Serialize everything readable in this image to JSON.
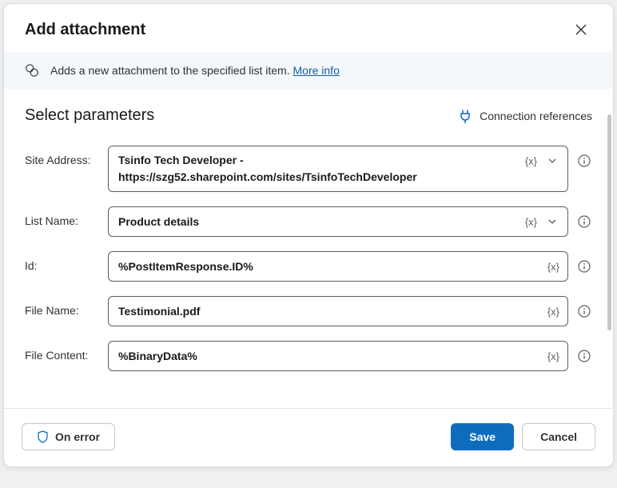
{
  "dialog": {
    "title": "Add attachment",
    "description": "Adds a new attachment to the specified list item.",
    "more_info_label": "More info"
  },
  "params": {
    "heading": "Select parameters",
    "connection_label": "Connection references"
  },
  "fields": {
    "site_address": {
      "label": "Site Address:",
      "value": "Tsinfo Tech Developer - https://szg52.sharepoint.com/sites/TsinfoTechDeveloper"
    },
    "list_name": {
      "label": "List Name:",
      "value": "Product details"
    },
    "id": {
      "label": "Id:",
      "value": "%PostItemResponse.ID%"
    },
    "file_name": {
      "label": "File Name:",
      "value": "Testimonial.pdf"
    },
    "file_content": {
      "label": "File Content:",
      "value": "%BinaryData%"
    }
  },
  "variable_token": "{x}",
  "footer": {
    "on_error": "On error",
    "save": "Save",
    "cancel": "Cancel"
  }
}
